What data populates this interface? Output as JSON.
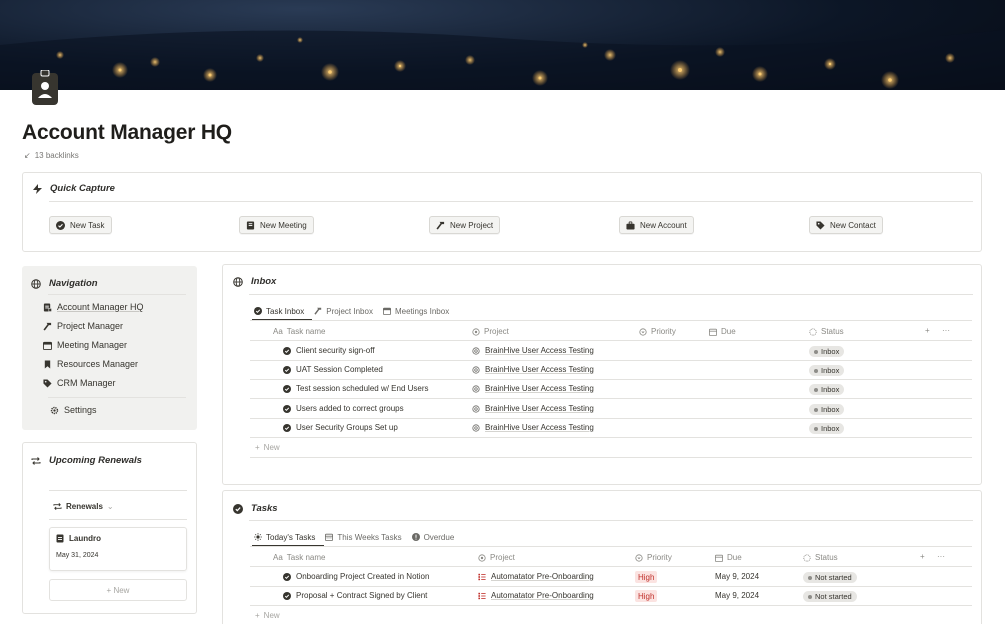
{
  "page": {
    "title": "Account Manager HQ",
    "backlinks": "13 backlinks"
  },
  "cover": {
    "description_icon": "night-earth-cover"
  },
  "quick_capture": {
    "title": "Quick Capture",
    "buttons": [
      {
        "label": "New Task",
        "icon": "check-circle-icon"
      },
      {
        "label": "New Meeting",
        "icon": "notebook-icon"
      },
      {
        "label": "New Project",
        "icon": "hammer-icon"
      },
      {
        "label": "New Account",
        "icon": "briefcase-icon"
      },
      {
        "label": "New Contact",
        "icon": "tag-icon"
      }
    ]
  },
  "navigation": {
    "title": "Navigation",
    "items": [
      {
        "label": "Account Manager HQ",
        "icon": "badge-icon"
      },
      {
        "label": "Project Manager",
        "icon": "hammer-icon"
      },
      {
        "label": "Meeting Manager",
        "icon": "calendar-icon"
      },
      {
        "label": "Resources Manager",
        "icon": "bookmark-icon"
      },
      {
        "label": "CRM Manager",
        "icon": "tag-icon"
      }
    ],
    "settings": "Settings"
  },
  "renewals": {
    "title": "Upcoming Renewals",
    "view": "Renewals",
    "card": {
      "name": "Laundro",
      "date": "May 31, 2024"
    },
    "new_label": "+ New"
  },
  "inbox": {
    "title": "Inbox",
    "tabs": [
      "Task Inbox",
      "Project Inbox",
      "Meetings Inbox"
    ],
    "columns": {
      "name": "Task name",
      "project": "Project",
      "priority": "Priority",
      "due": "Due",
      "status": "Status"
    },
    "rows": [
      {
        "name": "Client security sign-off",
        "project": "BrainHive User Access Testing",
        "status": "Inbox"
      },
      {
        "name": "UAT Session Completed",
        "project": "BrainHive User Access Testing",
        "status": "Inbox"
      },
      {
        "name": "Test session scheduled w/ End Users",
        "project": "BrainHive User Access Testing",
        "status": "Inbox"
      },
      {
        "name": "Users added to correct groups",
        "project": "BrainHive User Access Testing",
        "status": "Inbox"
      },
      {
        "name": "User Security Groups Set up",
        "project": "BrainHive User Access Testing",
        "status": "Inbox"
      }
    ],
    "new_label": "New"
  },
  "tasks": {
    "title": "Tasks",
    "tabs": [
      "Today's Tasks",
      "This Weeks Tasks",
      "Overdue"
    ],
    "columns": {
      "name": "Task name",
      "project": "Project",
      "priority": "Priority",
      "due": "Due",
      "status": "Status"
    },
    "rows": [
      {
        "name": "Onboarding Project Created in Notion",
        "project": "Automatator Pre-Onboarding",
        "priority": "High",
        "due": "May 9, 2024",
        "status": "Not started"
      },
      {
        "name": "Proposal + Contract Signed by Client",
        "project": "Automatator Pre-Onboarding",
        "priority": "High",
        "due": "May 9, 2024",
        "status": "Not started"
      }
    ],
    "new_label": "New"
  },
  "colors": {
    "accent_dark": "#37352f",
    "priority_bg": "#fbe3e1",
    "priority_text": "#c0302b",
    "pill_bg": "#e7e6e3"
  }
}
